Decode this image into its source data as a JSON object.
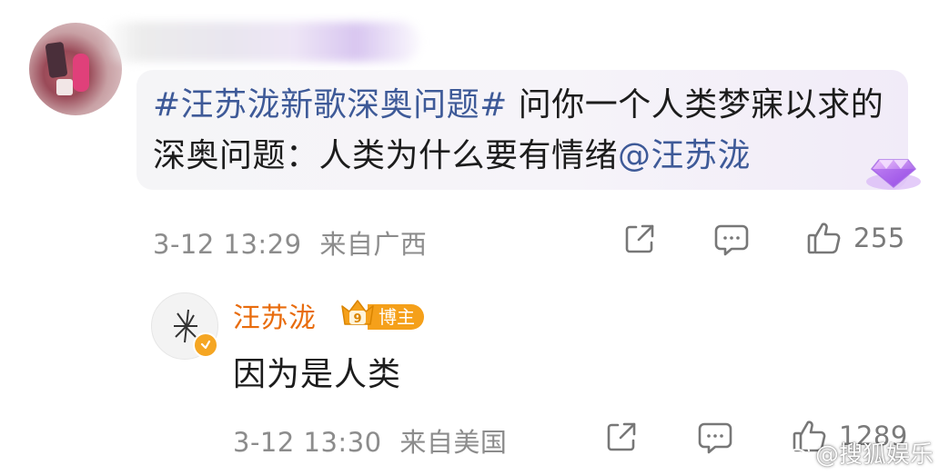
{
  "comment": {
    "hashtag": "#汪苏泷新歌深奥问题#",
    "body": "问你一个人类梦寐以求的深奥问题：人类为什么要有情绪",
    "mention": "@汪苏泷",
    "timestamp": "3-12 13:29",
    "location": "来自广西",
    "like_count": "255"
  },
  "reply": {
    "author": "汪苏泷",
    "badge_label": "博主",
    "badge_level": "9",
    "text": "因为是人类",
    "timestamp": "3-12 13:30",
    "location": "来自美国",
    "like_count": "1289"
  },
  "watermark": {
    "text": "@搜狐娱乐"
  },
  "colors": {
    "link": "#3e5a98",
    "author_name": "#e86b0c",
    "badge": "#f5a01a",
    "meta_gray": "#8c8c8c"
  },
  "icons": [
    "share-icon",
    "comment-icon",
    "like-icon",
    "gem-badge-icon",
    "crown-badge-icon",
    "verified-icon",
    "weibo-logo-icon"
  ]
}
